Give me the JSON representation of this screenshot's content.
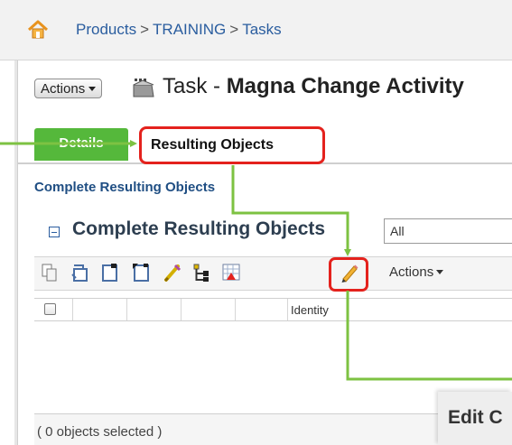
{
  "breadcrumb": {
    "items": [
      "Products",
      "TRAINING",
      "Tasks"
    ],
    "separator": ">"
  },
  "header": {
    "actions_label": "Actions",
    "title_prefix": "Task - ",
    "title_name": "Magna Change Activity"
  },
  "tabs": [
    {
      "label": "Details",
      "active": true
    },
    {
      "label": "Resulting Objects",
      "active": false
    }
  ],
  "subtitle": "Complete Resulting Objects",
  "section": {
    "title": "Complete Resulting Objects",
    "filter_value": "All"
  },
  "toolbar": {
    "icons": [
      "copy-icon",
      "paste-icon",
      "new-object-icon",
      "insert-object-icon",
      "magic-edit-icon",
      "structure-icon",
      "report-icon",
      "edit-pencil-icon"
    ],
    "actions_label": "Actions"
  },
  "table": {
    "columns": [
      "",
      "",
      "",
      "",
      "",
      "Identity"
    ],
    "rows": []
  },
  "footer": {
    "selected_text": "( 0 objects selected )"
  },
  "overlay": {
    "title": "Edit C"
  },
  "colors": {
    "highlight": "#e4221d",
    "arrow": "#7dc242",
    "tab_active": "#55b83b",
    "link": "#2a5d9f"
  }
}
